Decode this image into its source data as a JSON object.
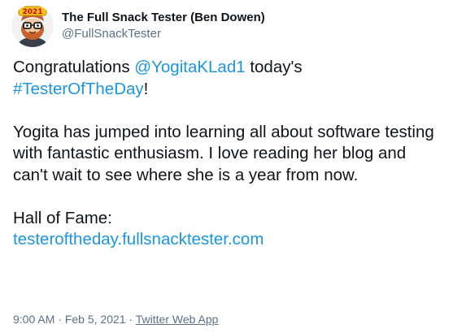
{
  "author": {
    "display_name": "The Full Snack Tester (Ben Dowen)",
    "handle": "@FullSnackTester",
    "avatar_badge_text": "2021"
  },
  "tweet": {
    "p1_text1": "Congratulations ",
    "p1_mention": "@YogitaKLad1",
    "p1_text2": " today's",
    "p1_hashtag": "#TesterOfTheDay",
    "p1_text3": "!",
    "p2": "Yogita has jumped into learning all about software testing with fantastic enthusiasm. I love reading her blog and can't wait to see where she is a year from now.",
    "p3_label": "Hall of Fame:",
    "p3_link": "testeroftheday.fullsnacktester.com"
  },
  "meta": {
    "time": "9:00 AM",
    "separator": " · ",
    "date": "Feb 5, 2021",
    "source": "Twitter Web App"
  },
  "colors": {
    "link": "#1b95e0",
    "text": "#0f1419",
    "secondary": "#5b7083"
  }
}
